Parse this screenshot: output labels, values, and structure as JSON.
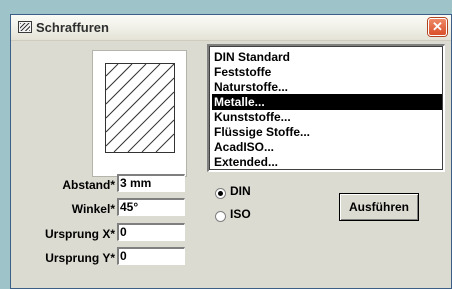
{
  "window": {
    "title": "Schraffuren",
    "close_icon": "close-icon"
  },
  "patterns": {
    "items": [
      "DIN Standard",
      "Feststoffe",
      "Naturstoffe...",
      "Metalle...",
      "Kunststoffe...",
      "Flüssige Stoffe...",
      "AcadISO...",
      "Extended..."
    ],
    "selected": "Metalle..."
  },
  "fields": {
    "abstand": {
      "label": "Abstand*",
      "value": "3 mm"
    },
    "winkel": {
      "label": "Winkel*",
      "value": "45°"
    },
    "ursprung_x": {
      "label": "Ursprung X*",
      "value": "0"
    },
    "ursprung_y": {
      "label": "Ursprung Y*",
      "value": "0"
    }
  },
  "standard": {
    "options": [
      "DIN",
      "ISO"
    ],
    "selected": "DIN"
  },
  "actions": {
    "apply_label": "Ausführen"
  },
  "colors": {
    "selection": "#000000",
    "close_button": "#d9502b"
  }
}
